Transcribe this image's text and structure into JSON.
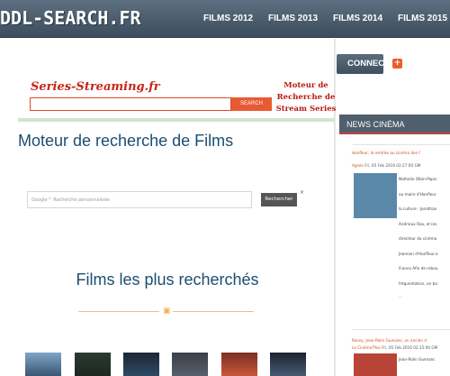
{
  "header": {
    "logo": "DDL-SEARCH.FR",
    "nav": [
      "FILMS 2012",
      "FILMS 2013",
      "FILMS 2014",
      "FILMS 2015"
    ]
  },
  "banner": {
    "brand": "Series-Streaming.fr",
    "search_button": "SEARCH",
    "tagline_lines": [
      "Moteur de",
      "Recherche de",
      "Stream Series"
    ]
  },
  "main": {
    "title": "Moteur de recherche de Films",
    "google_placeholder": "Google™ Recherche personnalisée",
    "google_button": "Rechercher",
    "close": "×",
    "popular_title": "Films les plus recherchés"
  },
  "sidebar": {
    "connect_label": "CONNEC",
    "plus": "+",
    "news_header": "NEWS CINÉMA",
    "item1": {
      "title": "Honfleur, la rentrée au cinéma des f",
      "author": "Agnès",
      "date": " Fri, 05 Feb 2016 02:27:00 GM",
      "lines": [
        "Nathalie Olbin-Papin",
        "au maire d'Honfleur",
        "la culture : Jonathan",
        "Andrieux Roa, et (es",
        "directeur du cinéma",
        "Jeannon d'Honfleur.e",
        "France Afin de rebou",
        "fréquentation, en ba",
        "..."
      ]
    },
    "item2": {
      "title": "Racey, Jean-Rolin Guenzec, un ancien d",
      "author": "Le Cinéma'Ploc",
      "date": " Fri, 05 Feb 2016 02:15:00 GM",
      "lines": [
        "Jean-Rolin Guenzec"
      ]
    }
  },
  "colors": {
    "header": "#4a5b6b",
    "heading": "#1b4e72",
    "accent": "#e85a33",
    "brand_red": "#c62617"
  }
}
